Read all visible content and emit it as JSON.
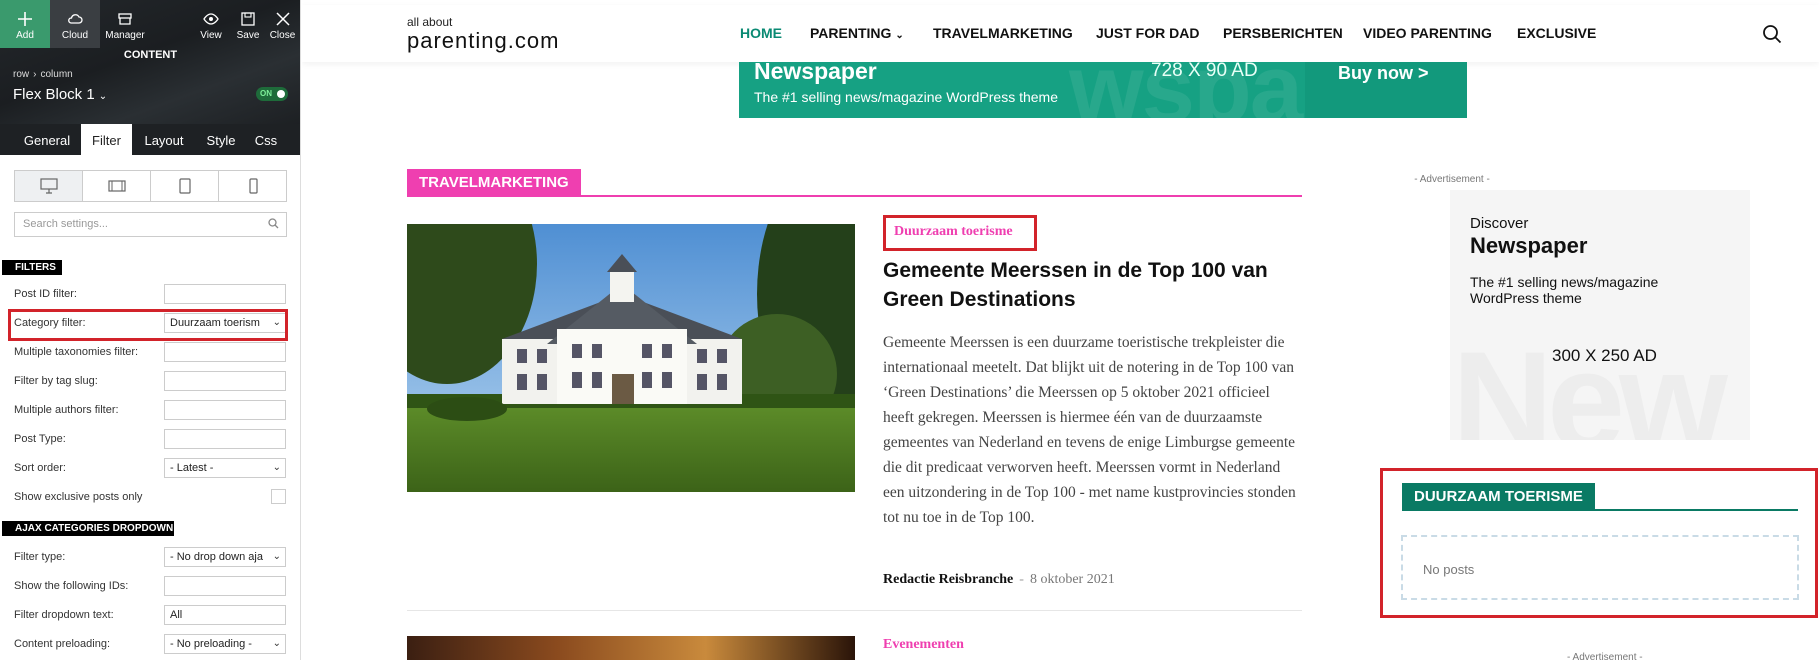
{
  "editor": {
    "toolbar": {
      "add": "Add",
      "cloud": "Cloud",
      "manager": "Manager",
      "view": "View",
      "save": "Save",
      "close": "Close"
    },
    "panel_title": "CONTENT",
    "breadcrumb": [
      "row",
      "column"
    ],
    "block_name": "Flex Block 1",
    "toggle_label": "ON",
    "tabs": [
      "General",
      "Filter",
      "Layout",
      "Style",
      "Css"
    ],
    "active_tab": "Filter",
    "search_placeholder": "Search settings...",
    "filters_heading": "FILTERS",
    "filters": [
      {
        "label": "Post ID filter:",
        "value": ""
      },
      {
        "label": "Category filter:",
        "value": "Duurzaam toerism"
      },
      {
        "label": "Multiple taxonomies filter:",
        "value": ""
      },
      {
        "label": "Filter by tag slug:",
        "value": ""
      },
      {
        "label": "Multiple authors filter:",
        "value": ""
      },
      {
        "label": "Post Type:",
        "value": ""
      },
      {
        "label": "Sort order:",
        "value": "- Latest -"
      },
      {
        "label": "Show exclusive posts only",
        "value": ""
      }
    ],
    "ajax_heading": "AJAX CATEGORIES DROPDOWN",
    "ajax": [
      {
        "label": "Filter type:",
        "value": "- No drop down aja"
      },
      {
        "label": "Show the following IDs:",
        "value": ""
      },
      {
        "label": "Filter dropdown text:",
        "value": "All"
      },
      {
        "label": "Content preloading:",
        "value": "- No preloading -"
      }
    ]
  },
  "site": {
    "logo_top": "all about",
    "logo_main": "parenting.com",
    "nav": [
      "HOME",
      "PARENTING",
      "TRAVELMARKETING",
      "JUST FOR DAD",
      "PERSBERICHTEN",
      "VIDEO PARENTING",
      "EXCLUSIVE"
    ],
    "active_nav": "HOME",
    "banner": {
      "name": "Newspaper",
      "tagline": "The #1 selling news/magazine WordPress theme",
      "size": "728 X 90 AD",
      "buy": "Buy now >"
    },
    "block_title": "TRAVELMARKETING",
    "post": {
      "category": "Duurzaam toerisme",
      "title": "Gemeente Meerssen in de Top 100 van Green Destinations",
      "excerpt": "Gemeente Meerssen is een duurzame toeristische trekpleister die internationaal meetelt. Dat blijkt uit de notering in de Top 100 van ‘Green Destinations’ die Meerssen op 5 oktober 2021 officieel heeft gekregen. Meerssen is hiermee één van de duurzaamste gemeentes van Nederland en tevens de enige Limburgse gemeente die dit predicaat verworven heeft. Meerssen vormt in Nederland een uitzondering in de Top 100 - met name kustprovincies stonden tot nu toe in de Top 100.",
      "author": "Redactie Reisbranche",
      "separator": "-",
      "date": "8 oktober 2021"
    },
    "post2_category": "Evenementen",
    "sidebar": {
      "ad_label": "- Advertisement -",
      "ad_discover": "Discover",
      "ad_name": "Newspaper",
      "ad_tagline": "The #1 selling news/magazine WordPress theme",
      "ad_size": "300 X 250 AD",
      "widget_title": "DUURZAAM TOERISME",
      "widget_empty": "No posts",
      "cut_text": "- Advertisement -"
    }
  },
  "colors": {
    "accent_green": "#0a8a73",
    "pink": "#ef3fb0",
    "highlight_red": "#d2232a",
    "banner_green": "#16a183"
  }
}
